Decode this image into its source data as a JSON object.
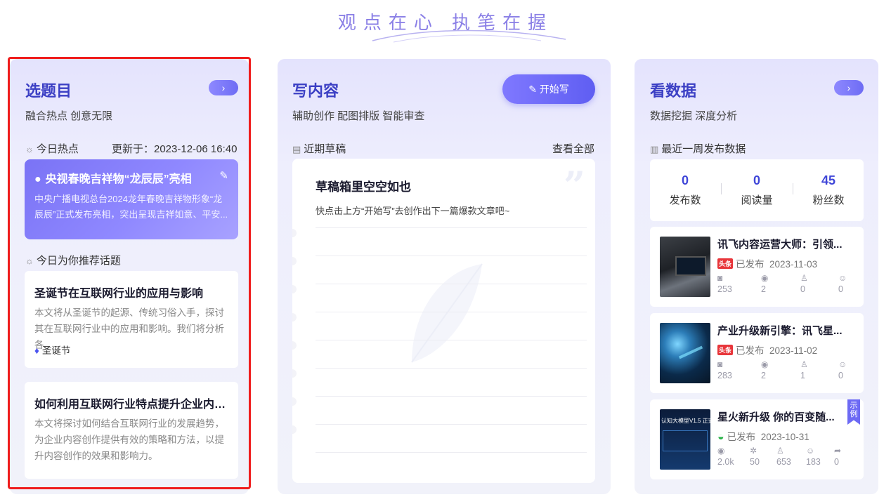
{
  "slogan": "观点在心  执笔在握",
  "col1": {
    "title": "选题目",
    "subtitle": "融合热点 创意无限",
    "arrow": "›",
    "hot_label": "今日热点",
    "updated": "更新于：2023-12-06 16:40",
    "hot_card": {
      "title": "央视春晚吉祥物“龙辰辰”亮相",
      "desc": "中央广播电视总台2024龙年春晚吉祥物形象“龙辰辰”正式发布亮相，突出呈现吉祥如意、平安..."
    },
    "rec_label": "今日为你推荐话题",
    "topics": [
      {
        "title": "圣诞节在互联网行业的应用与影响",
        "desc": "本文将从圣诞节的起源、传统习俗入手，探讨其在互联网行业中的应用和影响。我们将分析各...",
        "tag": "圣诞节"
      },
      {
        "title": "如何利用互联网行业特点提升企业内容...",
        "desc": "本文将探讨如何结合互联网行业的发展趋势，为企业内容创作提供有效的策略和方法，以提升内容创作的效果和影响力。"
      }
    ]
  },
  "col2": {
    "title": "写内容",
    "subtitle": "辅助创作 配图排版 智能审查",
    "start_btn": "开始写",
    "drafts_label": "近期草稿",
    "view_all": "查看全部",
    "empty_title": "草稿箱里空空如也",
    "empty_desc": "快点击上方“开始写”去创作出下一篇爆款文章吧~"
  },
  "col3": {
    "title": "看数据",
    "subtitle": "数据挖掘 深度分析",
    "arrow": "›",
    "week_label": "最近一周发布数据",
    "stats": [
      {
        "value": "0",
        "label": "发布数"
      },
      {
        "value": "0",
        "label": "阅读量"
      },
      {
        "value": "45",
        "label": "粉丝数"
      }
    ],
    "articles": [
      {
        "title": "讯飞内容运营大师：引领...",
        "platform_badge": "头条",
        "status": "已发布",
        "date": "2023-11-03",
        "metrics": [
          "253",
          "2",
          "0",
          "0"
        ]
      },
      {
        "title": "产业升级新引擎：讯飞星...",
        "platform_badge": "头条",
        "status": "已发布",
        "date": "2023-11-02",
        "metrics": [
          "283",
          "2",
          "1",
          "0"
        ]
      },
      {
        "title": "星火新升级 你的百变随...",
        "status": "已发布",
        "date": "2023-10-31",
        "metrics": [
          "2.0k",
          "50",
          "653",
          "183",
          "0"
        ],
        "thumb_text": "认知大模型V1.5 正式",
        "example_flag": "示例"
      }
    ]
  },
  "colors": {
    "accent": "#6e6cf4",
    "title_blue": "#3b3fc4",
    "highlight_frame": "#ef1d1d"
  }
}
